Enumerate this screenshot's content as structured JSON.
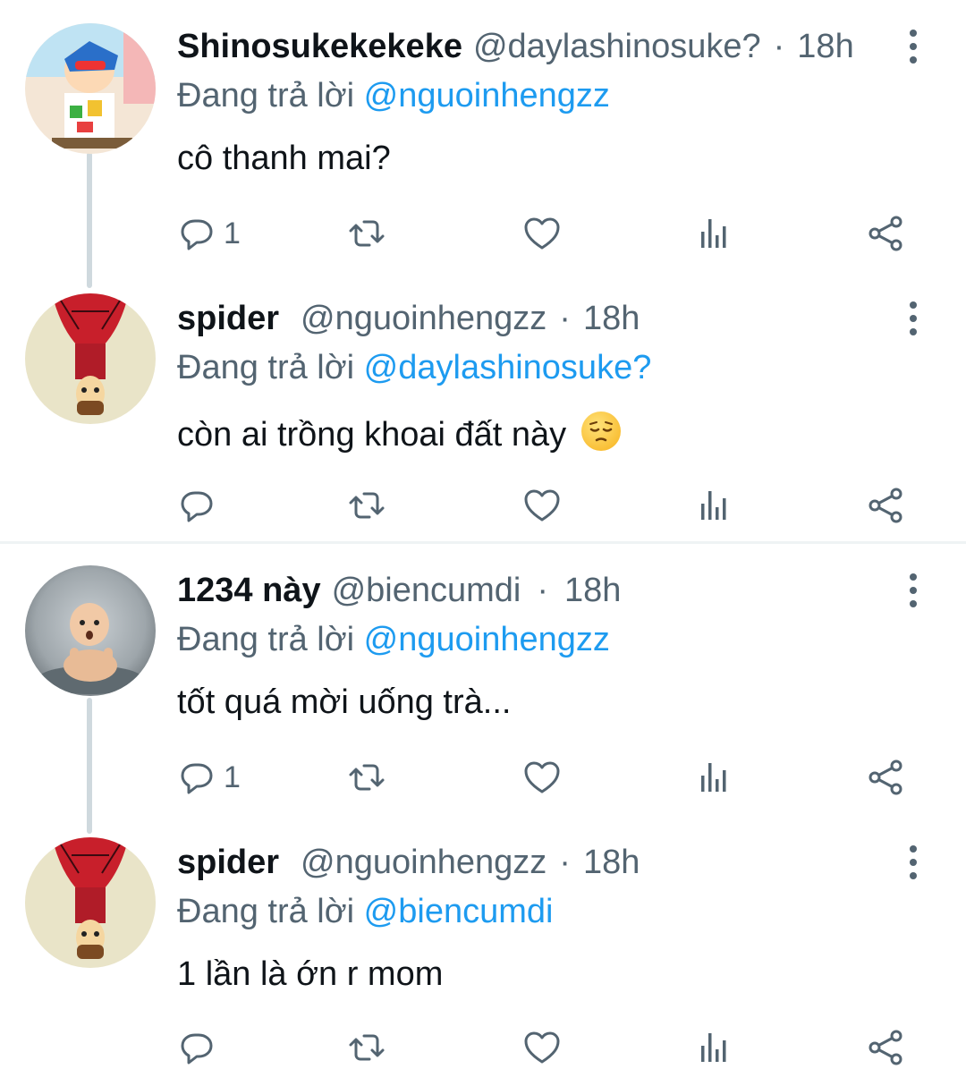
{
  "tweets": [
    {
      "name": "Shinosukekekeke",
      "handle": "@daylashinosuke?",
      "dot": "·",
      "time": "18h",
      "replying_prefix": "Đang trả lời",
      "replying_to": "@nguoinhengzz",
      "text": "cô thanh mai?",
      "reply_count": "1",
      "avatar_icon": "shinchan-avatar"
    },
    {
      "name": "spider",
      "handle": "@nguoinhengzz",
      "dot": "·",
      "time": "18h",
      "replying_prefix": "Đang trả lời",
      "replying_to": "@daylashinosuke?",
      "text": "còn ai trồng khoai đất này",
      "emoji": "pensive-face-emoji",
      "reply_count": "",
      "avatar_icon": "spiderman-toy-avatar"
    },
    {
      "name": "1234 này",
      "handle": "@biencumdi",
      "dot": "·",
      "time": "18h",
      "replying_prefix": "Đang trả lời",
      "replying_to": "@nguoinhengzz",
      "text": "tốt quá mời uống trà...",
      "reply_count": "1",
      "avatar_icon": "bald-baby-avatar"
    },
    {
      "name": "spider",
      "handle": "@nguoinhengzz",
      "dot": "·",
      "time": "18h",
      "replying_prefix": "Đang trả lời",
      "replying_to": "@biencumdi",
      "text": "1 lần là ớn r mom",
      "reply_count": "",
      "avatar_icon": "spiderman-toy-avatar"
    }
  ],
  "colors": {
    "text": "#0f1419",
    "secondary": "#536471",
    "link": "#1d9bf0",
    "thread_line": "#cfd9de",
    "divider": "#eff3f4"
  },
  "action_icons": [
    "reply-icon",
    "retweet-icon",
    "like-icon",
    "views-icon",
    "share-icon"
  ]
}
